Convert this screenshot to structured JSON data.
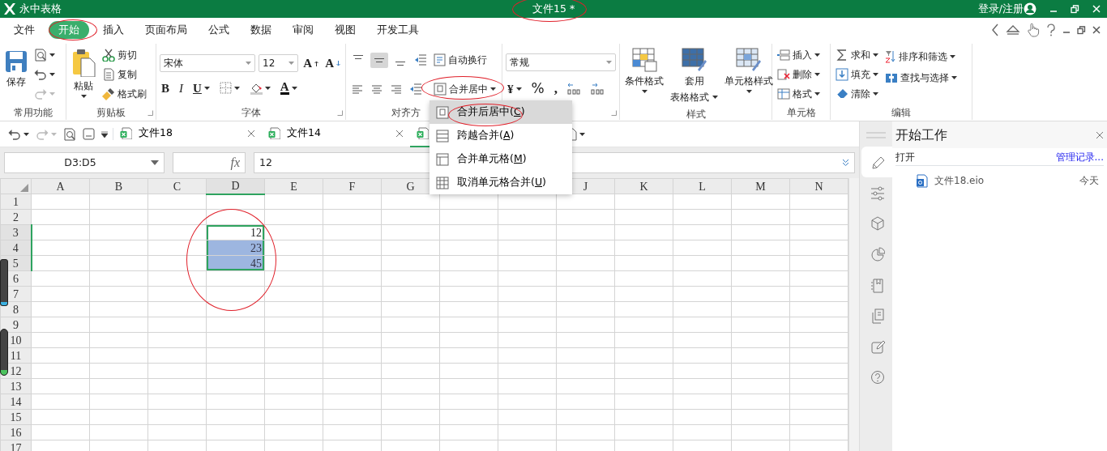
{
  "title_bar": {
    "app_name": "永中表格",
    "document_title": "文件15 *",
    "account": "登录/注册"
  },
  "menu_tabs": [
    {
      "label": "文件",
      "selected": false
    },
    {
      "label": "开始",
      "selected": true
    },
    {
      "label": "插入",
      "selected": false
    },
    {
      "label": "页面布局",
      "selected": false
    },
    {
      "label": "公式",
      "selected": false
    },
    {
      "label": "数据",
      "selected": false
    },
    {
      "label": "审阅",
      "selected": false
    },
    {
      "label": "视图",
      "selected": false
    },
    {
      "label": "开发工具",
      "selected": false
    }
  ],
  "ribbon": {
    "common": {
      "label": "常用功能",
      "save": "保存",
      "redo_disabled": true
    },
    "clipboard": {
      "label": "剪贴板",
      "paste": "粘贴",
      "cut": "剪切",
      "copy": "复制",
      "format_painter": "格式刷"
    },
    "font": {
      "label": "字体",
      "font_name": "宋体",
      "font_size": "12",
      "grow": "A",
      "shrink": "A",
      "bold": "B",
      "italic": "I",
      "underline": "U",
      "font_color": "A"
    },
    "alignment": {
      "label": "对齐方",
      "wrap_text": "自动换行",
      "merge_center": "合并居中",
      "vertical_align": [
        {
          "selected": false
        },
        {
          "selected": true
        },
        {
          "selected": false
        }
      ]
    },
    "number": {
      "format": "常规",
      "currency": "¥",
      "percent": "%",
      "comma": ","
    },
    "styles": {
      "label": "样式",
      "conditional": "条件格式",
      "table_format_1": "套用",
      "table_format_2": "表格格式",
      "cell_styles": "单元格样式"
    },
    "cells": {
      "label": "单元格",
      "insert": "插入",
      "delete": "删除",
      "format": "格式"
    },
    "editing": {
      "label": "编辑",
      "sum": "求和",
      "fill": "填充",
      "clear": "清除",
      "sort_filter": "排序和筛选",
      "find_select": "查找与选择"
    }
  },
  "doc_tabs": [
    {
      "label": "文件18",
      "selected": false
    },
    {
      "label": "文件14",
      "selected": false
    },
    {
      "selected": true
    }
  ],
  "formula_bar": {
    "name_box": "D3:D5",
    "fx": "fx",
    "value": "12"
  },
  "merge_menu": [
    {
      "label": "合并后居中(",
      "key": "C",
      "close": ")",
      "selected": true
    },
    {
      "label": "跨越合并(",
      "key": "A",
      "close": ")",
      "selected": false
    },
    {
      "label": "合并单元格(",
      "key": "M",
      "close": ")",
      "selected": false
    },
    {
      "label": "取消单元格合并(",
      "key": "U",
      "close": ")",
      "selected": false
    }
  ],
  "sheet": {
    "columns": [
      {
        "label": "A",
        "selected": false
      },
      {
        "label": "B",
        "selected": false
      },
      {
        "label": "C",
        "selected": false
      },
      {
        "label": "D",
        "selected": true
      },
      {
        "label": "E",
        "selected": false
      },
      {
        "label": "F",
        "selected": false
      },
      {
        "label": "G",
        "selected": false
      },
      {},
      {},
      {
        "label": "J",
        "selected": false
      },
      {
        "label": "K",
        "selected": false
      },
      {
        "label": "L",
        "selected": false
      },
      {
        "label": "M",
        "selected": false
      },
      {
        "label": "N",
        "selected": false
      }
    ],
    "rows": [
      {
        "label": "1",
        "selected": false
      },
      {
        "label": "2",
        "selected": false
      },
      {
        "label": "3",
        "selected": true,
        "cells": [
          null,
          null,
          null,
          {
            "value": "12",
            "selected": true,
            "active": true
          }
        ]
      },
      {
        "label": "4",
        "selected": true,
        "cells": [
          null,
          null,
          null,
          {
            "value": "23",
            "selected": true,
            "active": false
          }
        ]
      },
      {
        "label": "5",
        "selected": true,
        "cells": [
          null,
          null,
          null,
          {
            "value": "45",
            "selected": true,
            "active": false
          }
        ]
      },
      {
        "label": "6",
        "selected": false
      },
      {
        "label": "7",
        "selected": false
      },
      {
        "label": "8",
        "selected": false
      },
      {
        "label": "9",
        "selected": false
      },
      {
        "label": "10",
        "selected": false
      },
      {
        "label": "11",
        "selected": false
      },
      {
        "label": "12",
        "selected": false
      },
      {
        "label": "13",
        "selected": false
      },
      {
        "label": "14",
        "selected": false
      },
      {
        "label": "15",
        "selected": false
      },
      {
        "label": "16",
        "selected": false
      },
      {
        "label": "17",
        "selected": false
      }
    ]
  },
  "task_pane": {
    "title": "开始工作",
    "open_label": "打开",
    "manage_link": "管理记录...",
    "recent": [
      {
        "name": "文件18.eio",
        "date": "今天"
      }
    ],
    "side_tabs": [
      {
        "selected": true
      },
      {
        "selected": false
      },
      {
        "selected": false
      },
      {
        "selected": false
      },
      {
        "selected": false
      },
      {
        "selected": false
      },
      {
        "selected": false
      },
      {
        "selected": false
      }
    ]
  }
}
